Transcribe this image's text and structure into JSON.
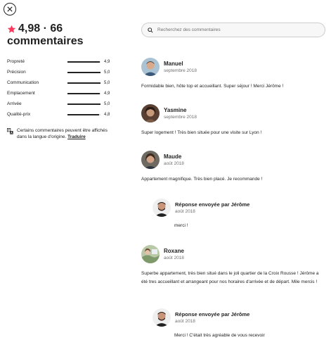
{
  "header": {
    "close_label": "×"
  },
  "summary": {
    "rating_line": "4,98 · 66",
    "reviews_word": "commentaires",
    "star_color": "#FF385C"
  },
  "categories": [
    {
      "label": "Propreté",
      "value": "4,9",
      "fraction": 0.98
    },
    {
      "label": "Précision",
      "value": "5,0",
      "fraction": 1.0
    },
    {
      "label": "Communication",
      "value": "5,0",
      "fraction": 1.0
    },
    {
      "label": "Emplacement",
      "value": "4,9",
      "fraction": 0.98
    },
    {
      "label": "Arrivée",
      "value": "5,0",
      "fraction": 1.0
    },
    {
      "label": "Qualité-prix",
      "value": "4,8",
      "fraction": 0.96
    }
  ],
  "translation": {
    "note": "Certains commentaires peuvent être affichés dans la langue d'origine.",
    "link": "Traduire"
  },
  "search": {
    "placeholder": "Recherchez des commentaires"
  },
  "reviews": [
    {
      "name": "Manuel",
      "date": "septembre 2018",
      "text": "Formidable bien, hôte top et accueillant. Super séjour ! Merci Jérôme !"
    },
    {
      "name": "Yasmine",
      "date": "septembre 2018",
      "text": "Super logement ! Très bien située pour une visite sur Lyon !"
    },
    {
      "name": "Maude",
      "date": "août 2018",
      "text": "Appartement magnifique. Très bien placé. Je recommande !"
    },
    {
      "name": "Roxane",
      "date": "août 2018",
      "text": "Superbe appartement, très bien situé dans le joli quartier de la Croix Rousse ! Jérôme a été tres accueillant et arrangeant pour nos horaires d'arrivée et de départ. Mile mercis !"
    }
  ],
  "replies": [
    {
      "title": "Réponse envoyée par Jérôme",
      "date": "août 2018",
      "text": "merci !"
    },
    {
      "title": "Réponse envoyée par Jérôme",
      "date": "août 2018",
      "text": "Merci ! C'était très agréable de vous recevoir"
    }
  ]
}
